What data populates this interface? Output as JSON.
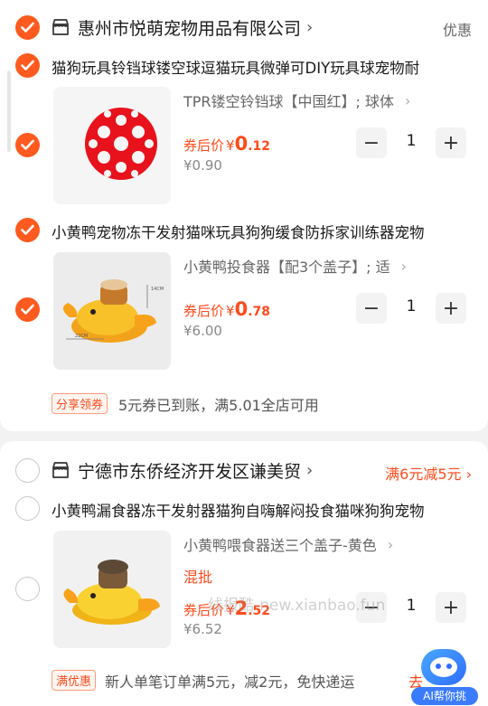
{
  "shops": [
    {
      "name": "惠州市悦萌宠物用品有限公司",
      "chevron": "›",
      "promo": "优惠",
      "items": [
        {
          "title": "猫狗玩具铃铛球镂空球逗猫玩具微弹可DIY玩具球宠物耐",
          "sku": "TPR镂空铃铛球【中国红】; 球体",
          "price_label": "券后价",
          "yen": "¥",
          "price_int": "0",
          "price_dec": ".12",
          "orig_price": "¥0.90",
          "qty": "1"
        },
        {
          "title": "小黄鸭宠物冻干发射猫咪玩具狗狗缓食防拆家训练器宠物",
          "sku": "小黄鸭投食器【配3个盖子】; 适",
          "price_label": "券后价",
          "yen": "¥",
          "price_int": "0",
          "price_dec": ".78",
          "orig_price": "¥6.00",
          "qty": "1",
          "dims": {
            "h": "14CM",
            "w": "22CM"
          }
        }
      ],
      "coupon_badge": "分享领券",
      "coupon_text": "5元券已到账，满5.01全店可用"
    },
    {
      "name": "宁德市东侨经济开发区谦美贸",
      "chevron": "›",
      "promo": "满6元减5元 ›",
      "items": [
        {
          "title": "小黄鸭漏食器冻干发射器猫狗自嗨解闷投食猫咪狗狗宠物",
          "sku": "小黄鸭喂食器送三个盖子-黄色",
          "mix_tag": "混批",
          "price_label": "券后价",
          "yen": "¥",
          "price_int": "2",
          "price_dec": ".52",
          "orig_price": "¥6.52",
          "qty": "1"
        }
      ],
      "deal_badge": "满优惠",
      "deal_text": "新人单笔订单满5元，减2元，免快递运",
      "deal_link": "去"
    }
  ],
  "stepper": {
    "minus": "−",
    "plus": "+"
  },
  "sku_arrow": "›",
  "watermark": "线报酷-new.xianbao.fun",
  "ai_assistant": {
    "label": "AI帮你挑"
  },
  "colors": {
    "accent": "#ff5a1f",
    "price": "#ff4a1a",
    "background": "#f2f2f2"
  }
}
